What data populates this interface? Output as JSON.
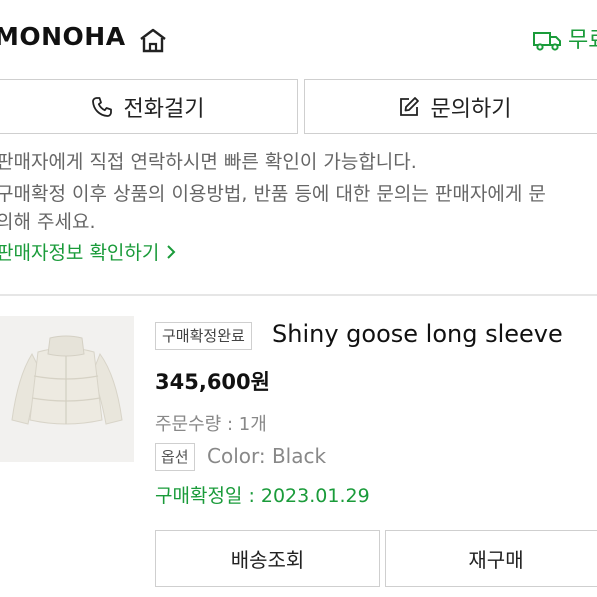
{
  "header": {
    "brand": "MONOHA",
    "shipping_label": "무료"
  },
  "contact": {
    "call_label": "전화걸기",
    "inquiry_label": "문의하기"
  },
  "notice": {
    "line1": "판매자에게 직접 연락하시면 빠른 확인이 가능합니다.",
    "line2": "구매확정 이후 상품의 이용방법, 반품 등에 대한 문의는 판매자에게 문",
    "line3": "의해 주세요.",
    "seller_info_link": "판매자정보 확인하기"
  },
  "order": {
    "status_badge": "구매확정완료",
    "product_name": "Shiny goose long sleeve",
    "price": "345,600원",
    "quantity": "주문수량 : 1개",
    "option_label": "옵션",
    "option_value": "Color: Black",
    "confirm_date": "구매확정일 : 2023.01.29",
    "track_button": "배송조회",
    "rebuy_button": "재구매"
  },
  "colors": {
    "accent_green": "#1a9b3a",
    "border": "#cfcfcf"
  },
  "icons": [
    "home-icon",
    "truck-icon",
    "phone-icon",
    "edit-icon",
    "chevron-right-icon"
  ]
}
